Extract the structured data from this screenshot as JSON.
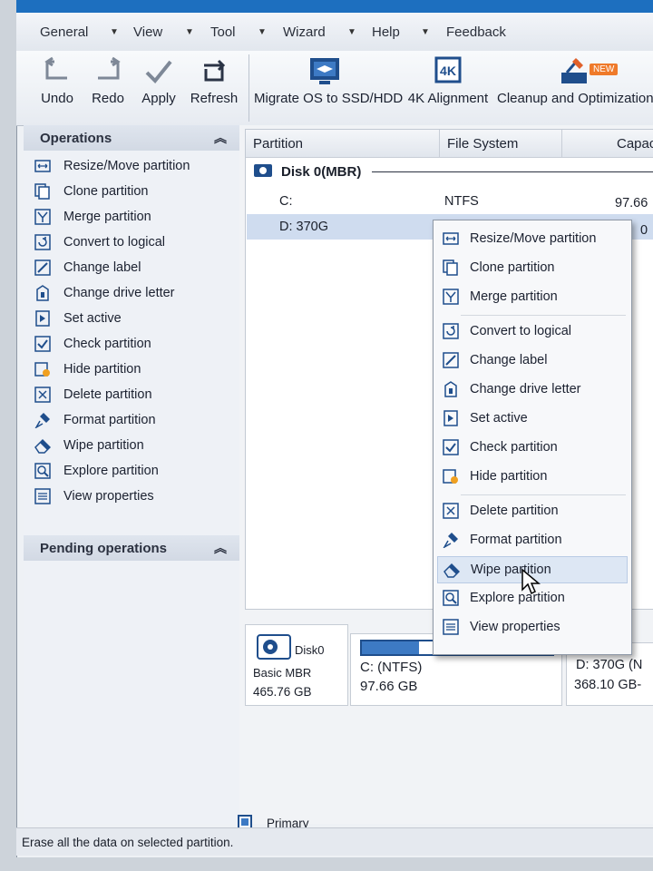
{
  "menubar": {
    "items": [
      "General",
      "View",
      "Tool",
      "Wizard",
      "Help",
      "Feedback"
    ]
  },
  "toolbar": {
    "undo": "Undo",
    "redo": "Redo",
    "apply": "Apply",
    "refresh": "Refresh",
    "migrate": "Migrate OS to SSD/HDD",
    "alignment": "4K Alignment",
    "cleanup": "Cleanup and Optimization",
    "new_badge": "NEW",
    "alignment_icon_text": "4K"
  },
  "operations": {
    "title": "Operations",
    "items": [
      "Resize/Move partition",
      "Clone partition",
      "Merge partition",
      "Convert to logical",
      "Change label",
      "Change drive letter",
      "Set active",
      "Check partition",
      "Hide partition",
      "Delete partition",
      "Format partition",
      "Wipe partition",
      "Explore partition",
      "View properties"
    ]
  },
  "pending": {
    "title": "Pending operations"
  },
  "grid": {
    "columns": [
      "Partition",
      "File System",
      "Capac"
    ],
    "disk_label": "Disk 0(MBR)",
    "rows": [
      {
        "partition": "C:",
        "fs": "NTFS",
        "capacity": "97.66"
      },
      {
        "partition": "D: 370G",
        "fs": "",
        "capacity": "0"
      }
    ]
  },
  "context_menu": {
    "items": [
      "Resize/Move partition",
      "Clone partition",
      "Merge partition",
      "Convert to logical",
      "Change label",
      "Change drive letter",
      "Set active",
      "Check partition",
      "Hide partition",
      "Delete partition",
      "Format partition",
      "Wipe partition",
      "Explore partition",
      "View properties"
    ],
    "highlighted": "Wipe partition"
  },
  "diskmap": {
    "disk_name": "Disk0",
    "disk_type": "Basic MBR",
    "disk_size": "465.76 GB",
    "c_label": "C: (NTFS)",
    "c_size": "97.66 GB",
    "c_used_fraction": 0.3,
    "d_label": "D: 370G (N",
    "d_size": "368.10 GB-"
  },
  "legend": {
    "primary": "Primary"
  },
  "status": {
    "text": "Erase all the data on selected partition."
  },
  "colors": {
    "accent": "#1d6fbf",
    "selection": "#cfdcef",
    "icon": "#1f4e8c"
  }
}
